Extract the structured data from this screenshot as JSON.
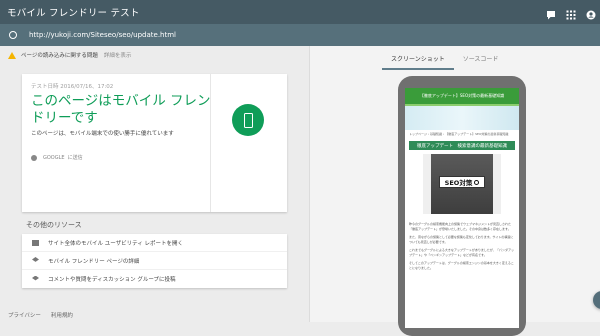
{
  "app": {
    "title": "モバイル フレンドリー テスト",
    "url": "http://yukoji.com/Siteseo/seo/update.html"
  },
  "warning": {
    "text": "ページの読み込みに関する問題",
    "detail_link": "詳細を表示"
  },
  "result": {
    "meta": "テスト日時  2016/07/16、17:02",
    "headline": "このページはモバイル フレンドリーです",
    "description": "このページは、モバイル端末での使い勝手に優れています",
    "google_label": "GOOGLE",
    "google_action": "に送信"
  },
  "resources": {
    "title": "その他のリソース",
    "items": [
      {
        "label": "サイト全体のモバイル ユーザビリティ レポートを開く"
      },
      {
        "label": "モバイル フレンドリー ページの詳細"
      },
      {
        "label": "コメントや質問をディスカッション グループに投稿"
      }
    ]
  },
  "footer": {
    "privacy": "プライバシー",
    "terms": "利用規約"
  },
  "tabs": [
    {
      "label": "スクリーンショット"
    },
    {
      "label": "ソースコード"
    }
  ],
  "preview": {
    "site_header": "【徹底アップデート】SEO対策の最新基礎知識",
    "breadcrumb": "トップページ › 基礎知識 › 【徹底アップデート】SEO対策の最新基礎知識",
    "post_title": "徹底アップデート　検索意識の最新基礎知識",
    "hero_label": "SEO対策",
    "paragraphs": [
      "昨今のグーグルの検索機能向上の施策でウェブマネジメントが見直しされた「徹底アップデート」が登場いたしました。その中身は数多く存在します。",
      "また、昔ながらの施策として必要な施策も変化しております。サイトの構造についても見直しが必要です。",
      "これまでもグーグルによる大きなアップデートがありましたが、「パンダアップデート」や「ペンギンアップデート」などが有名です。",
      "そしてこのアップデートは、グーグルの検索エンジンの基本を大きく変えることになりました。"
    ]
  },
  "colors": {
    "appbar": "#455a64",
    "urlbar": "#56707b",
    "accent_green": "#0f9d58",
    "warning": "#f4b400"
  }
}
